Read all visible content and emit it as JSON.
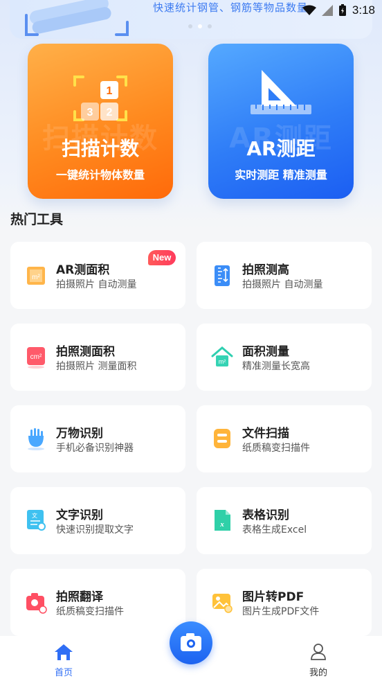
{
  "banner": {
    "text": "快速统计钢管、钢筋等物品数量",
    "dots": 3,
    "active_dot": 2
  },
  "status_bar": {
    "time": "3:18"
  },
  "big_cards": {
    "scan": {
      "title": "扫描计数",
      "subtitle": "一键统计物体数量",
      "watermark": "扫描计数",
      "numbers": [
        "1",
        "3",
        "2"
      ]
    },
    "ar": {
      "title": "AR测距",
      "subtitle": "实时测距 精准测量",
      "watermark": "AR测距"
    }
  },
  "section_title": "热门工具",
  "tools": [
    {
      "title": "AR测面积",
      "subtitle": "拍摄照片 自动测量",
      "icon": "ar-area-icon",
      "badge": "New"
    },
    {
      "title": "拍照测高",
      "subtitle": "拍摄照片 自动测量",
      "icon": "measure-height-icon"
    },
    {
      "title": "拍照测面积",
      "subtitle": "拍摄照片 测量面积",
      "icon": "photo-area-icon"
    },
    {
      "title": "面积测量",
      "subtitle": "精准测量长宽高",
      "icon": "house-area-icon"
    },
    {
      "title": "万物识别",
      "subtitle": "手机必备识别神器",
      "icon": "hand-recognize-icon"
    },
    {
      "title": "文件扫描",
      "subtitle": "纸质稿变扫描件",
      "icon": "file-scan-icon"
    },
    {
      "title": "文字识别",
      "subtitle": "快速识别提取文字",
      "icon": "text-recognize-icon"
    },
    {
      "title": "表格识别",
      "subtitle": "表格生成Excel",
      "icon": "excel-icon"
    },
    {
      "title": "拍照翻译",
      "subtitle": "纸质稿变扫描件",
      "icon": "camera-translate-icon"
    },
    {
      "title": "图片转PDF",
      "subtitle": "图片生成PDF文件",
      "icon": "image-pdf-icon"
    }
  ],
  "nav": {
    "home": "首页",
    "mine": "我的"
  },
  "colors": {
    "accent_blue": "#2f6ef5",
    "scan_orange": "#ff8a1f",
    "badge_red": "#ff4a5a"
  }
}
